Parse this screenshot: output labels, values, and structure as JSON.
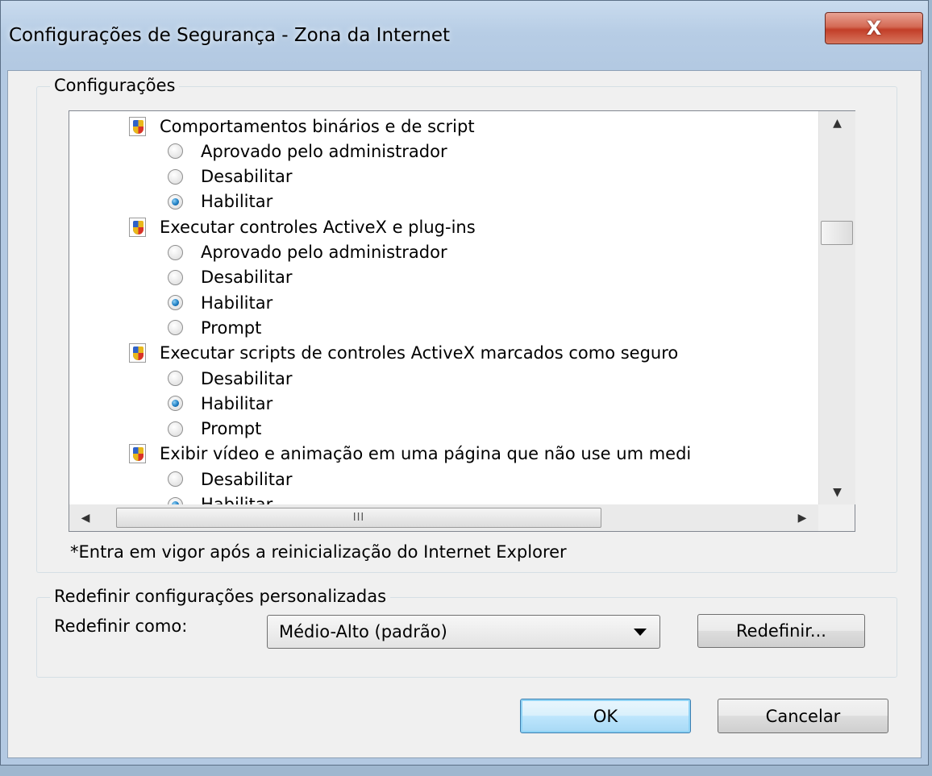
{
  "window": {
    "title": "Configurações de Segurança - Zona da Internet",
    "close_label": "X"
  },
  "settings_group": {
    "legend": "Configurações",
    "rows": [
      {
        "kind": "category",
        "label": "Comportamentos binários e de script"
      },
      {
        "kind": "option",
        "label": "Aprovado pelo administrador",
        "checked": false
      },
      {
        "kind": "option",
        "label": "Desabilitar",
        "checked": false
      },
      {
        "kind": "option",
        "label": "Habilitar",
        "checked": true
      },
      {
        "kind": "category",
        "label": "Executar controles ActiveX e plug-ins"
      },
      {
        "kind": "option",
        "label": "Aprovado pelo administrador",
        "checked": false
      },
      {
        "kind": "option",
        "label": "Desabilitar",
        "checked": false
      },
      {
        "kind": "option",
        "label": "Habilitar",
        "checked": true
      },
      {
        "kind": "option",
        "label": "Prompt",
        "checked": false
      },
      {
        "kind": "category",
        "label": "Executar scripts de controles ActiveX marcados como seguro"
      },
      {
        "kind": "option",
        "label": "Desabilitar",
        "checked": false
      },
      {
        "kind": "option",
        "label": "Habilitar",
        "checked": true
      },
      {
        "kind": "option",
        "label": "Prompt",
        "checked": false
      },
      {
        "kind": "category",
        "label": "Exibir vídeo e animação em uma página que não use um medi"
      },
      {
        "kind": "option",
        "label": "Desabilitar",
        "checked": false
      },
      {
        "kind": "option",
        "label": "Habilitar",
        "checked": true
      }
    ],
    "hscroll_grip": "III",
    "note": "*Entra em vigor após a reinicialização do Internet Explorer"
  },
  "reset_group": {
    "legend": "Redefinir configurações personalizadas",
    "reset_to_label": "Redefinir como:",
    "selected_level": "Médio-Alto (padrão)",
    "reset_button": "Redefinir..."
  },
  "footer": {
    "ok": "OK",
    "cancel": "Cancelar"
  }
}
